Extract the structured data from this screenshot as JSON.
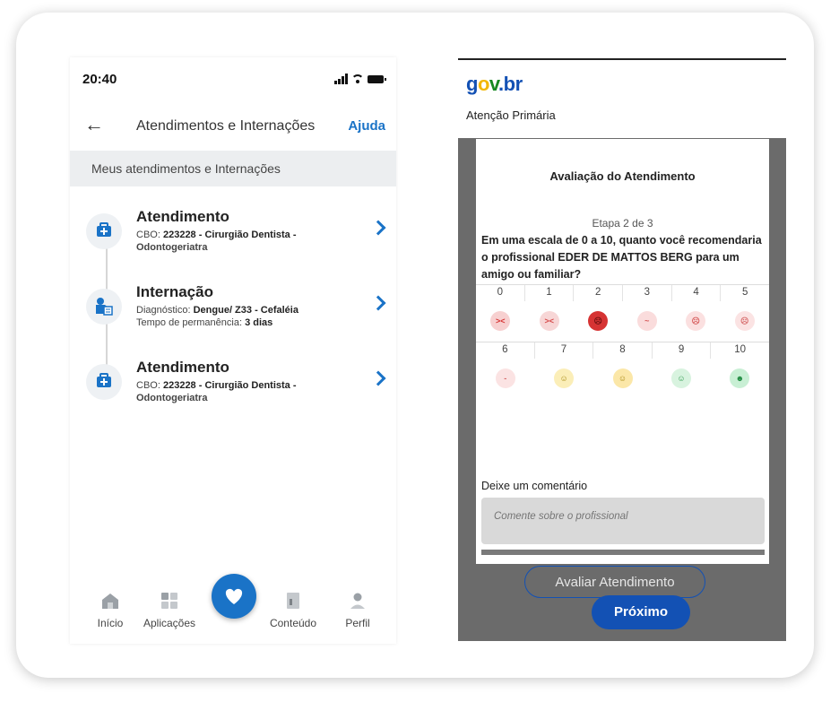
{
  "phone": {
    "status_time": "20:40",
    "title": "Atendimentos e Internações",
    "help": "Ajuda",
    "section": "Meus atendimentos e Internações",
    "items": [
      {
        "title": "Atendimento",
        "l1_label": "CBO:",
        "l1_value": "223228 - Cirurgião Dentista -",
        "l2": "Odontogeriatra"
      },
      {
        "title": "Internação",
        "l1_label": "Diagnóstico:",
        "l1_value": "Dengue/ Z33 - Cefaléia",
        "l2_label": "Tempo de permanência:",
        "l2_value": "3 dias"
      },
      {
        "title": "Atendimento",
        "l1_label": "CBO:",
        "l1_value": "223228 - Cirurgião Dentista -",
        "l2": "Odontogeriatra"
      }
    ],
    "nav": [
      "Início",
      "Aplicações",
      "Conteúdo",
      "Perfil"
    ]
  },
  "web": {
    "logo": {
      "g": "g",
      "o": "o",
      "v": "v",
      "dot": ".",
      "br": "br"
    },
    "subtitle": "Atenção Primária",
    "modal_title": "Avaliação do Atendimento",
    "step": "Etapa 2 de 3",
    "question": "Em uma escala de 0 a 10, quanto você recomendaria o profissional EDER DE MATTOS BERG para um amigo ou familiar?",
    "scale_row1": [
      "0",
      "1",
      "2",
      "3",
      "4",
      "5"
    ],
    "scale_row2": [
      "6",
      "7",
      "8",
      "9",
      "10"
    ],
    "selected": "2",
    "comment_label": "Deixe um comentário",
    "comment_placeholder": "Comente sobre o profissional",
    "next_button": "Próximo",
    "rate_button": "Avaliar Atendimento"
  },
  "colors": {
    "accent": "#1a73c7",
    "govblue": "#1351b4",
    "selected_face": "#d63333"
  }
}
